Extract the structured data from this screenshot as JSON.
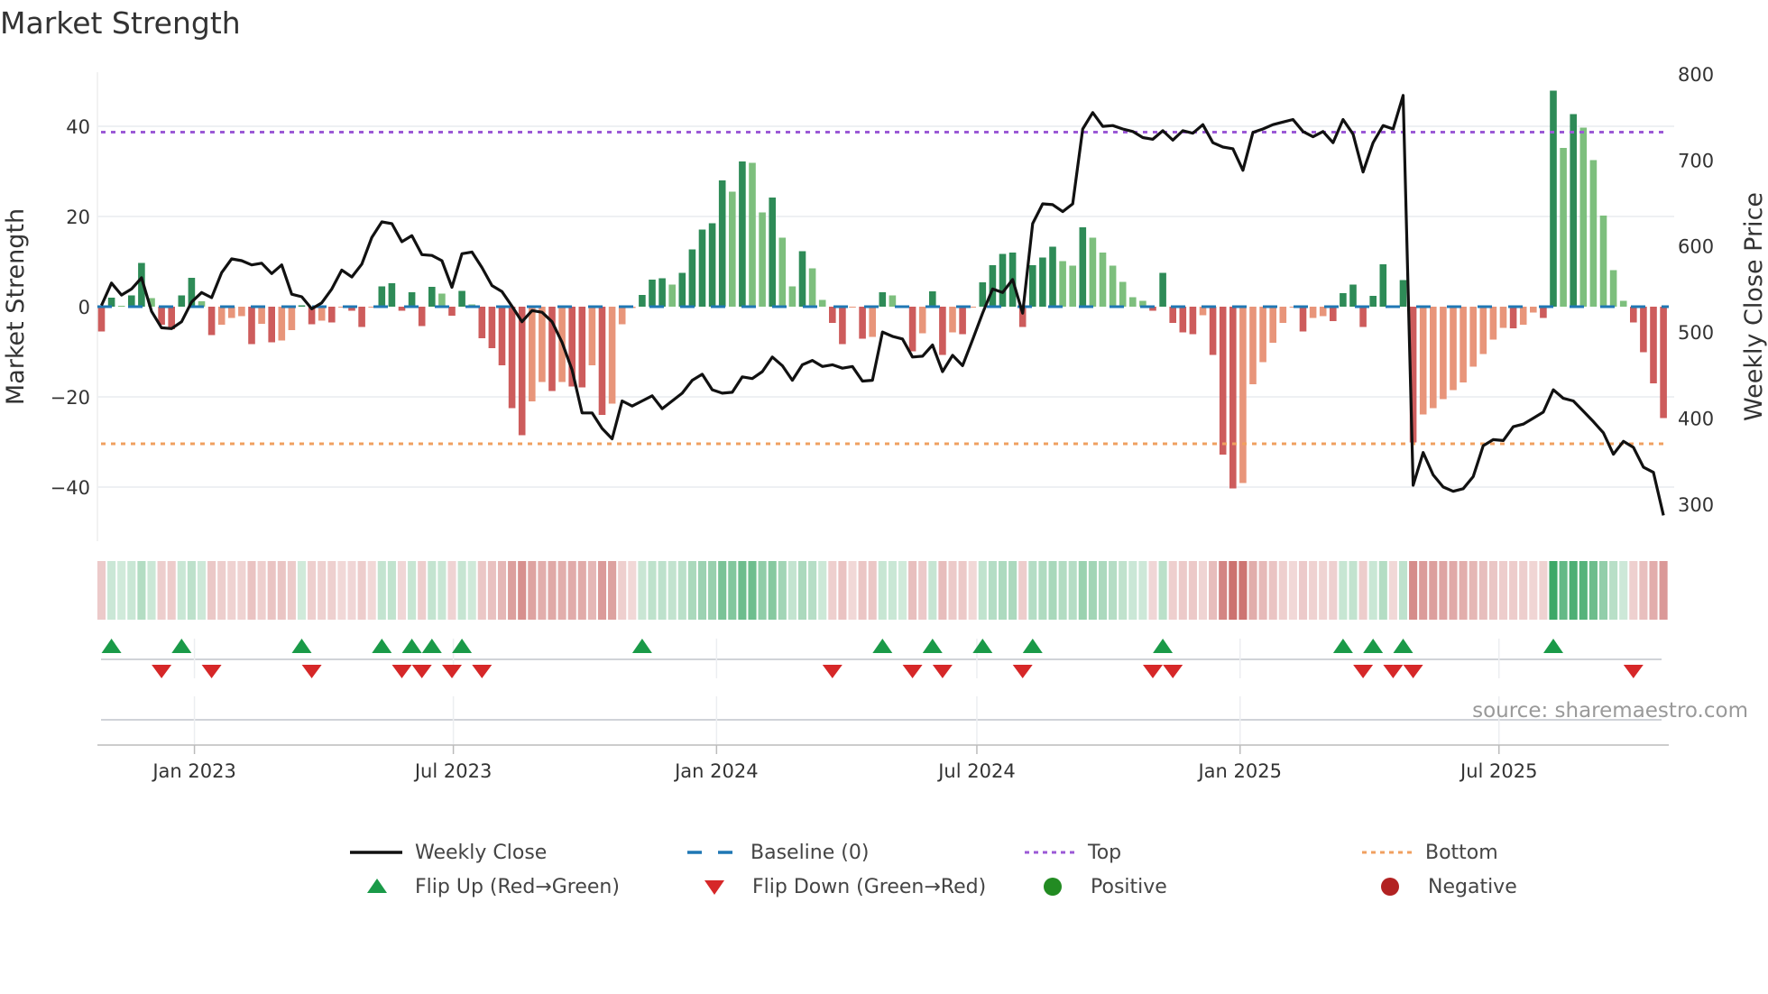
{
  "title": "Market Strength",
  "source": "source: sharemaestro.com",
  "legend": {
    "weekly_close": "Weekly Close",
    "baseline": "Baseline (0)",
    "top": "Top",
    "bottom": "Bottom",
    "flip_up": "Flip Up (Red→Green)",
    "flip_down": "Flip Down (Green→Red)",
    "positive": "Positive",
    "negative": "Negative"
  },
  "colors": {
    "rising_positive": "#2e8b57",
    "falling_positive": "#7dbf7d",
    "falling_negative": "#cd5c5c",
    "rising_negative": "#e8957a",
    "price_line": "#111111",
    "baseline": "#1f77b4",
    "top": "#9b59d6",
    "bottom": "#f0a060",
    "flip_up": "#1a9a48",
    "flip_down": "#d62728",
    "positive": "#228b22",
    "negative": "#b22222",
    "heat_positive": "#2ca05a",
    "heat_negative": "#c0504d"
  },
  "chart_data": {
    "type": "bar",
    "title": "Market Strength",
    "xlabel": "",
    "ylabel": "Market Strength",
    "y2label": "Weekly Close Price",
    "frequency": "weekly",
    "start_date": "2022-10-28",
    "ylim": [
      -52,
      52
    ],
    "y2lim": [
      257,
      802
    ],
    "yticks": [
      {
        "v": 40,
        "label": "40"
      },
      {
        "v": 20,
        "label": "20"
      },
      {
        "v": 0,
        "label": "0"
      },
      {
        "v": -20,
        "label": "−20"
      },
      {
        "v": -40,
        "label": "−40"
      }
    ],
    "y2ticks": [
      {
        "v": 800,
        "label": "800"
      },
      {
        "v": 700,
        "label": "700"
      },
      {
        "v": 600,
        "label": "600"
      },
      {
        "v": 500,
        "label": "500"
      },
      {
        "v": 400,
        "label": "400"
      },
      {
        "v": 300,
        "label": "300"
      }
    ],
    "xticks": [
      {
        "date": "2023-01-01",
        "label": "Jan 2023"
      },
      {
        "date": "2023-07-01",
        "label": "Jul 2023"
      },
      {
        "date": "2024-01-01",
        "label": "Jan 2024"
      },
      {
        "date": "2024-07-01",
        "label": "Jul 2024"
      },
      {
        "date": "2025-01-01",
        "label": "Jan 2025"
      },
      {
        "date": "2025-07-01",
        "label": "Jul 2025"
      }
    ],
    "top_level": 38.7,
    "bottom_level": -30.4,
    "baseline": 0,
    "grid": true,
    "legend_position": "bottom",
    "strength": [
      -5.5,
      2,
      0.2,
      2.5,
      9.7,
      1.9,
      -4,
      -5,
      2.5,
      6.4,
      1.2,
      -6.3,
      -4,
      -2.5,
      -2.1,
      -8.3,
      -3.8,
      -7.9,
      -7.5,
      -5.2,
      0.3,
      -3.9,
      -3.1,
      -3.5,
      -0.2,
      -0.9,
      -4.5,
      -0.2,
      4.5,
      5.2,
      -0.9,
      3.2,
      -4.3,
      4.4,
      2.9,
      -2,
      3.5,
      0.5,
      -7,
      -9.2,
      -13,
      -22.5,
      -28.5,
      -21,
      -16.7,
      -18.7,
      -16.7,
      -17.7,
      -17.9,
      -13,
      -24,
      -21.5,
      -3.9,
      -0.3,
      2.6,
      6,
      6.3,
      4.9,
      7.5,
      12.7,
      17.1,
      18.5,
      28,
      25.5,
      32.2,
      31.9,
      20.9,
      24.2,
      15.3,
      4.5,
      12.3,
      8.5,
      1.5,
      -3.6,
      -8.3,
      -0.2,
      -7.1,
      -6.7,
      3.2,
      2.5,
      0.2,
      -9.9,
      -5.9,
      3.4,
      -10.7,
      -5.7,
      -6.1,
      -0.2,
      5.4,
      9.2,
      11.7,
      12,
      -4.5,
      9.2,
      10.9,
      13.3,
      10.1,
      9.1,
      17.6,
      15.3,
      12,
      9.1,
      5.5,
      2.1,
      1.3,
      -0.9,
      7.5,
      -3.6,
      -5.7,
      -6.1,
      -1.9,
      -10.7,
      -32.8,
      -40.3,
      -39.1,
      -17.2,
      -12.3,
      -8,
      -3.6,
      -0.2,
      -5.5,
      -2.5,
      -2.1,
      -3.2,
      3,
      4.9,
      -4.5,
      2.4,
      9.4,
      -0.2,
      5.9,
      -30.1,
      -23.9,
      -22.5,
      -20.5,
      -18.5,
      -16.8,
      -13.3,
      -10.5,
      -7.3,
      -4.7,
      -4.8,
      -4,
      -1.3,
      -2.5,
      47.9,
      35.2,
      42.7,
      39.7,
      32.5,
      20.2,
      8.1,
      1.3,
      -3.5,
      -10.1,
      -17,
      -24.7
    ],
    "weekly_close": [
      531,
      557,
      543,
      550,
      563,
      524,
      505,
      504,
      512,
      535,
      546,
      540,
      569,
      585,
      583,
      578,
      580,
      568,
      578,
      544,
      541,
      527,
      534,
      550,
      572,
      564,
      579,
      610,
      628,
      626,
      605,
      612,
      590,
      589,
      583,
      552,
      591,
      593,
      575,
      554,
      547,
      530,
      512,
      525,
      523,
      512,
      488,
      456,
      406,
      406,
      388,
      376,
      420,
      414,
      420,
      426,
      411,
      420,
      429,
      444,
      451,
      433,
      429,
      430,
      448,
      446,
      454,
      471,
      461,
      444,
      462,
      467,
      460,
      462,
      458,
      460,
      443,
      444,
      500,
      495,
      492,
      471,
      472,
      485,
      454,
      473,
      461,
      491,
      522,
      550,
      546,
      561,
      522,
      626,
      649,
      648,
      640,
      649,
      736,
      755,
      739,
      740,
      736,
      733,
      726,
      724,
      734,
      723,
      734,
      731,
      741,
      720,
      715,
      713,
      688,
      732,
      736,
      741,
      744,
      747,
      733,
      727,
      733,
      720,
      747,
      730,
      686,
      720,
      740,
      736,
      775,
      322,
      360,
      334,
      320,
      315,
      318,
      332,
      368,
      375,
      374,
      390,
      393,
      400,
      407,
      433,
      423,
      420,
      408,
      396,
      383,
      358,
      373,
      366,
      343,
      337,
      287
    ]
  }
}
